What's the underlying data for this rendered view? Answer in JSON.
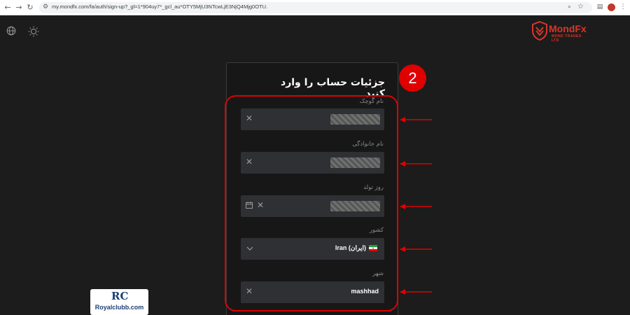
{
  "browser": {
    "url": "my.mondfx.com/fa/auth/sign-up?_gl=1*904uy7*_gcl_au*OTY5MjU3NTcwLjE3NjQ4Mjg0OTU.",
    "icons": [
      "back-icon",
      "forward-icon",
      "reload-icon",
      "site-info-icon",
      "zoom-icon",
      "bookmark-star-icon",
      "extensions-icon",
      "menu-icon"
    ]
  },
  "logo": {
    "name": "MondFx",
    "subtitle": "MOND TRADES LTD"
  },
  "form": {
    "title": "جزئیات حساب را وارد کنید",
    "step_number": "2",
    "fields": [
      {
        "label": "نام کوچک",
        "value": ""
      },
      {
        "label": "نام خانوادگی",
        "value": ""
      },
      {
        "label": "روز تولد",
        "value": ""
      },
      {
        "label": "کشور",
        "value": "Iran (ایران)"
      },
      {
        "label": "شهر",
        "value": "mashhad"
      }
    ]
  },
  "watermark": {
    "mark": "RC",
    "text": "Royalclubb.com"
  },
  "colors": {
    "accent": "#e00000",
    "brand": "#d9362b",
    "background": "#1c1c1c",
    "field": "#2e3033"
  }
}
